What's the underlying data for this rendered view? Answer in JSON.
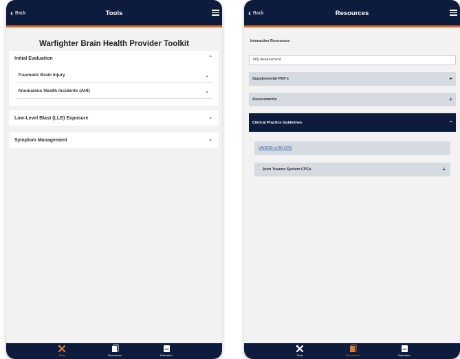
{
  "left": {
    "back_label": "Back",
    "title": "Tools",
    "toolkit_title": "Warfighter Brain Health Provider Toolkit",
    "sections": [
      {
        "label": "Initial Evaluation",
        "caret": "⌃"
      },
      {
        "label": "Low-Level Blast (LLB) Exposure",
        "caret": "⌄"
      },
      {
        "label": "Symptom Management",
        "caret": "⌄"
      }
    ],
    "subitems": [
      {
        "label": "Traumatic Brain Injury",
        "caret": "⌄"
      },
      {
        "label": "Anomalous Health Incidents (AHI)",
        "caret": "⌄"
      }
    ]
  },
  "right": {
    "back_label": "Back",
    "title": "Resources",
    "interactive_label": "Interactive Resources",
    "nsi_label": "NSI Assessment",
    "accordions": [
      {
        "label": "Supplemental PDF's",
        "sign": "+"
      },
      {
        "label": "Assessments",
        "sign": "+"
      },
      {
        "label": "Clinical Practice Guidelines",
        "sign": "−"
      }
    ],
    "cpg_link": "VA/DOD mTBI CPG",
    "jts_label": "Joint Trauma System CPGs",
    "jts_sign": "+"
  },
  "tabs": [
    {
      "label": "Tools",
      "icon": "tools-icon"
    },
    {
      "label": "Resources",
      "icon": "resources-icon"
    },
    {
      "label": "Education",
      "icon": "education-icon"
    }
  ],
  "colors": {
    "navy": "#0d1b3c",
    "accent_orange": "#e07a32",
    "link_blue": "#2a5fae",
    "accordion_gray": "#d6dae1"
  }
}
